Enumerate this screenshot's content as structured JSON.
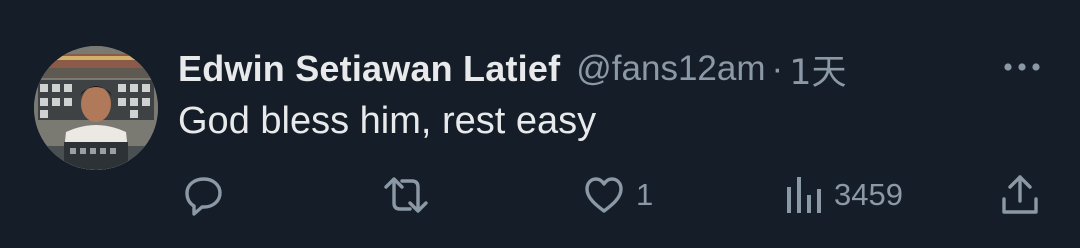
{
  "tweet": {
    "display_name": "Edwin Setiawan Latief",
    "handle": "@fans12am",
    "separator": "·",
    "time": "1天",
    "text": "God bless him, rest easy"
  },
  "actions": {
    "reply": {
      "icon": "reply-icon",
      "count": ""
    },
    "retweet": {
      "icon": "retweet-icon",
      "count": ""
    },
    "like": {
      "icon": "heart-icon",
      "count": "1"
    },
    "views": {
      "icon": "views-chart-icon",
      "count": "3459"
    },
    "share": {
      "icon": "share-icon",
      "count": ""
    }
  },
  "colors": {
    "background": "#151d28",
    "text_primary": "#e7e9ea",
    "text_secondary": "#8b98a5"
  }
}
